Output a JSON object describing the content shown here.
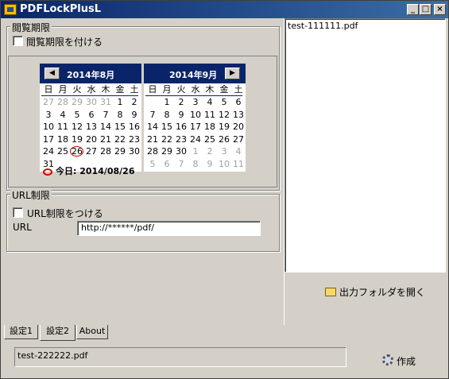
{
  "window": {
    "title": "PDFLockPlusL",
    "controls": [
      "_",
      "□",
      "×"
    ]
  },
  "expiry": {
    "group_label": "閲覧期限",
    "checkbox_label": "閲覧期限を付ける",
    "checked": false,
    "calendar_left": {
      "title": "2014年8月",
      "weekdays": [
        "日",
        "月",
        "火",
        "水",
        "木",
        "金",
        "土"
      ],
      "days": [
        [
          "27",
          "28",
          "29",
          "30",
          "31",
          "1",
          "2"
        ],
        [
          "3",
          "4",
          "5",
          "6",
          "7",
          "8",
          "9"
        ],
        [
          "10",
          "11",
          "12",
          "13",
          "14",
          "15",
          "16"
        ],
        [
          "17",
          "18",
          "19",
          "20",
          "21",
          "22",
          "23"
        ],
        [
          "24",
          "25",
          "26",
          "27",
          "28",
          "29",
          "30"
        ],
        [
          "31",
          "",
          "",
          "",
          "",
          "",
          ""
        ]
      ]
    },
    "calendar_right": {
      "title": "2014年9月",
      "weekdays": [
        "日",
        "月",
        "火",
        "水",
        "木",
        "金",
        "土"
      ],
      "days": [
        [
          "",
          "1",
          "2",
          "3",
          "4",
          "5",
          "6"
        ],
        [
          "7",
          "8",
          "9",
          "10",
          "11",
          "12",
          "13"
        ],
        [
          "14",
          "15",
          "16",
          "17",
          "18",
          "19",
          "20"
        ],
        [
          "21",
          "22",
          "23",
          "24",
          "25",
          "26",
          "27"
        ],
        [
          "28",
          "29",
          "30",
          "1",
          "2",
          "3",
          "4"
        ],
        [
          "5",
          "6",
          "7",
          "8",
          "9",
          "10",
          "11"
        ]
      ]
    },
    "today_label": "今日: 2014/08/26",
    "nav_prev": "◀",
    "nav_next": "▶"
  },
  "url": {
    "group_label": "URL制限",
    "checkbox_label": "URL制限をつける",
    "field_label": "URL",
    "field_value": "http://******/pdf/",
    "checked": false
  },
  "file_list": {
    "items": [
      "test-111111.pdf"
    ]
  },
  "buttons": {
    "open_folder": "出力フォルダを開く",
    "create": "作成"
  },
  "tabs": [
    {
      "label": "設定1",
      "active": false
    },
    {
      "label": "設定2",
      "active": true
    },
    {
      "label": "About",
      "active": false
    }
  ],
  "output": {
    "file_name": "test-222222.pdf"
  }
}
